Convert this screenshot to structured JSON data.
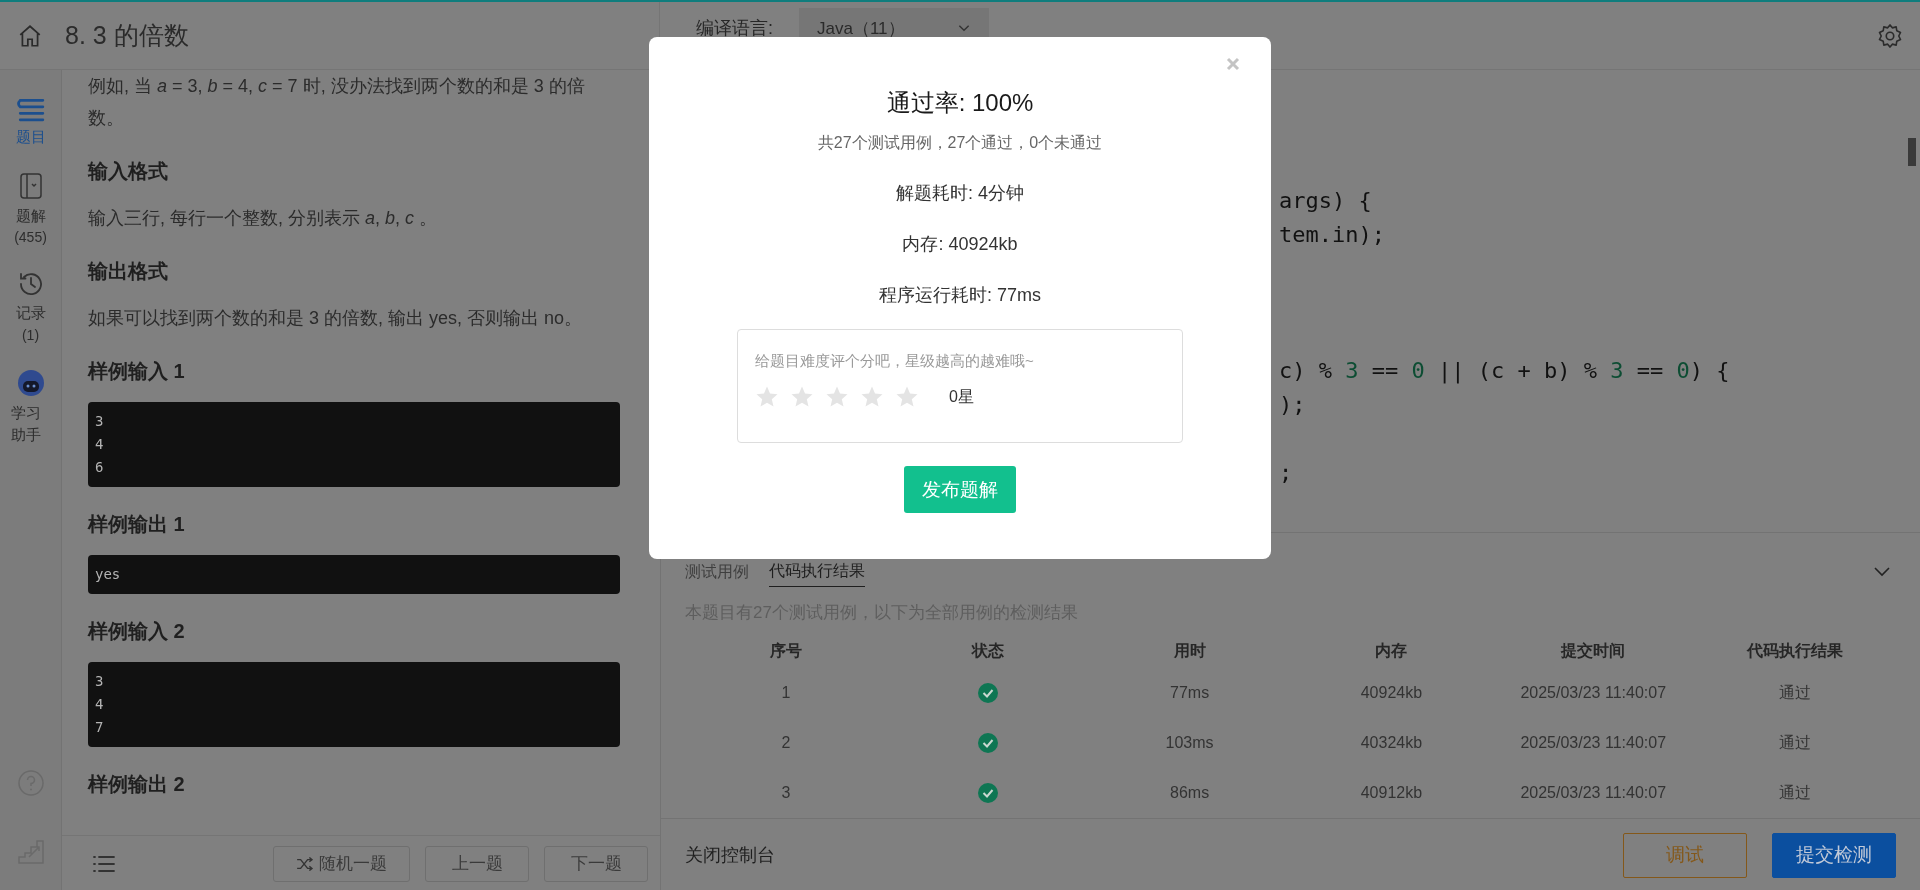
{
  "header": {
    "title": "8. 3 的倍数"
  },
  "compiler": {
    "label": "编译语言:",
    "value": "Java（11）"
  },
  "rail": {
    "items": [
      {
        "kind": "problem",
        "label": "题目",
        "selected": true
      },
      {
        "kind": "solutions",
        "label": "题解",
        "count": "(455)",
        "selected": false
      },
      {
        "kind": "records",
        "label": "记录",
        "count": "(1)",
        "selected": false
      },
      {
        "kind": "assistant",
        "label": "学习助手",
        "selected": false
      }
    ]
  },
  "problem": {
    "sections": [
      {
        "kind": "paragraph",
        "text": "例如, 当 *a* = 3, *b* = 4, *c* = 7 时, 没办法找到两个数的和是 3 的倍数。"
      },
      {
        "kind": "heading",
        "text": "输入格式"
      },
      {
        "kind": "paragraph",
        "text": "输入三行, 每行一个整数, 分别表示 *a*, *b*, *c* 。"
      },
      {
        "kind": "heading",
        "text": "输出格式"
      },
      {
        "kind": "paragraph",
        "text": "如果可以找到两个数的和是 3 的倍数, 输出 yes, 否则输出 no。"
      },
      {
        "kind": "heading",
        "text": "样例输入 1"
      },
      {
        "kind": "code",
        "lines": [
          "3",
          "4",
          "6"
        ]
      },
      {
        "kind": "heading",
        "text": "样例输出 1"
      },
      {
        "kind": "code",
        "lines": [
          "yes"
        ]
      },
      {
        "kind": "heading",
        "text": "样例输入 2"
      },
      {
        "kind": "code",
        "lines": [
          "3",
          "4",
          "7"
        ]
      },
      {
        "kind": "heading",
        "text": "样例输出 2"
      }
    ]
  },
  "problem_nav": {
    "buttons": [
      "随机一题",
      "上一题",
      "下一题"
    ]
  },
  "code_lines": [
    "args) {",
    "tem.in);",
    "c) % 3 == 0 || (c + b) % 3 == 0) {",
    ");",
    ";"
  ],
  "console": {
    "tabs": [
      {
        "label": "测试用例",
        "selected": false
      },
      {
        "label": "代码执行结果",
        "selected": true
      }
    ],
    "summary": "本题目有27个测试用例，以下为全部用例的检测结果",
    "columns": [
      "序号",
      "状态",
      "用时",
      "内存",
      "提交时间",
      "代码执行结果"
    ],
    "rows": [
      {
        "index": "1",
        "passed": true,
        "time": "77ms",
        "memory": "40924kb",
        "submitted": "2025/03/23 11:40:07",
        "result": "通过"
      },
      {
        "index": "2",
        "passed": true,
        "time": "103ms",
        "memory": "40324kb",
        "submitted": "2025/03/23 11:40:07",
        "result": "通过"
      },
      {
        "index": "3",
        "passed": true,
        "time": "86ms",
        "memory": "40912kb",
        "submitted": "2025/03/23 11:40:07",
        "result": "通过"
      }
    ]
  },
  "footer": {
    "close_label": "关闭控制台",
    "debug_button": "调试",
    "submit_button": "提交检测"
  },
  "modal": {
    "title": "通过率: 100%",
    "summary": "共27个测试用例，27个通过，0个未通过",
    "stats": [
      "解题耗时: 4分钟",
      "内存: 40924kb",
      "程序运行耗时: 77ms"
    ],
    "rating": {
      "prompt": "给题目难度评个分吧，星级越高的越难哦~",
      "stars": 0,
      "reading": "0星"
    },
    "publish_button": "发布题解"
  }
}
